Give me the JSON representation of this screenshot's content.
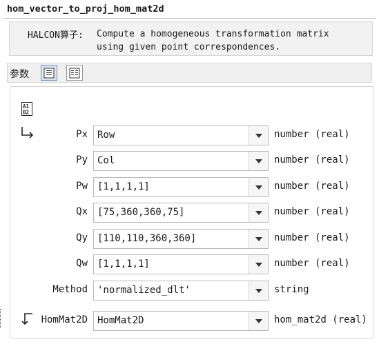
{
  "window": {
    "title": "hom_vector_to_proj_hom_mat2d"
  },
  "description": {
    "label": "HALCON算子:",
    "text": "Compute a homogeneous transformation matrix\nusing given point correspondences."
  },
  "section": {
    "label": "参数"
  },
  "params": [
    {
      "name": "Px",
      "value": "Row",
      "type": "number (real)"
    },
    {
      "name": "Py",
      "value": "Col",
      "type": "number (real)"
    },
    {
      "name": "Pw",
      "value": "[1,1,1,1]",
      "type": "number (real)"
    },
    {
      "name": "Qx",
      "value": "[75,360,360,75]",
      "type": "number (real)"
    },
    {
      "name": "Qy",
      "value": "[110,110,360,360]",
      "type": "number (real)"
    },
    {
      "name": "Qw",
      "value": "[1,1,1,1]",
      "type": "number (real)"
    },
    {
      "name": "Method",
      "value": "'normalized_dlt'",
      "type": "string"
    }
  ],
  "output": {
    "name": "HomMat2D",
    "value": "HomMat2D",
    "type": "hom_mat2d (real)"
  },
  "icons": {
    "ab_icon": "ab-variable-icon",
    "input_arrow": "input-arrow-icon",
    "output_arrow": "output-arrow-icon",
    "list_view": "list-view-icon",
    "table_view": "table-view-icon"
  }
}
